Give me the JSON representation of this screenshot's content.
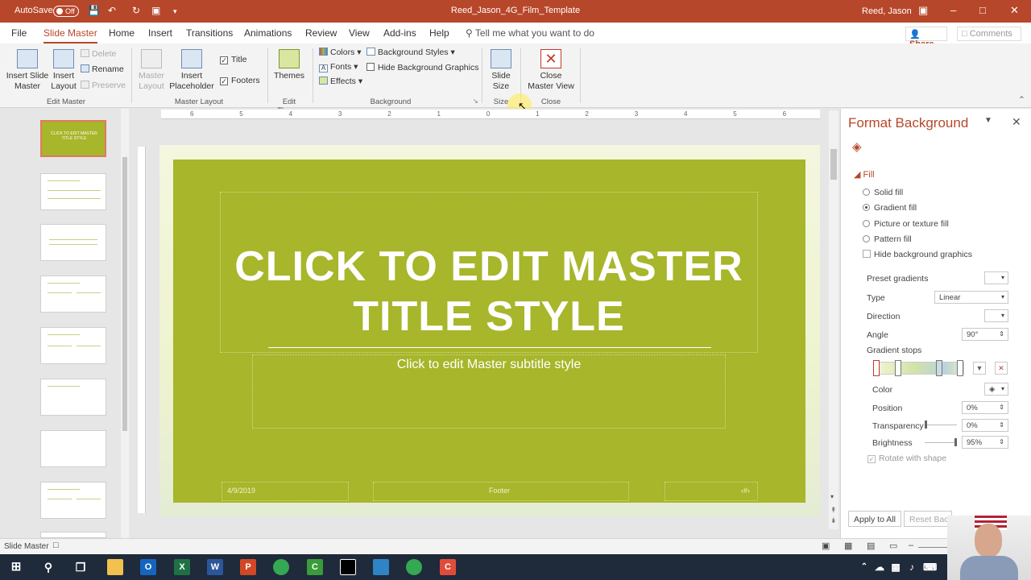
{
  "titlebar": {
    "autosave_label": "AutoSave",
    "autosave_state": "Off",
    "document_title": "Reed_Jason_4G_Film_Template",
    "user_name": "Reed, Jason"
  },
  "menu": {
    "tabs": [
      "File",
      "Slide Master",
      "Home",
      "Insert",
      "Transitions",
      "Animations",
      "Review",
      "View",
      "Add-ins",
      "Help"
    ],
    "active_tab": "Slide Master",
    "tell_me": "Tell me what you want to do",
    "share": "Share",
    "comments": "Comments"
  },
  "ribbon": {
    "insert_slide_master": "Insert Slide\nMaster",
    "insert_layout": "Insert\nLayout",
    "delete": "Delete",
    "rename": "Rename",
    "preserve": "Preserve",
    "master_layout": "Master\nLayout",
    "insert_placeholder": "Insert\nPlaceholder",
    "title_check": "Title",
    "footers_check": "Footers",
    "themes": "Themes",
    "colors": "Colors",
    "fonts": "Fonts",
    "effects": "Effects",
    "background_styles": "Background Styles",
    "hide_background_graphics": "Hide Background Graphics",
    "slide_size": "Slide\nSize",
    "close_master_view": "Close\nMaster View",
    "groups": {
      "edit_master": "Edit Master",
      "master_layout": "Master Layout",
      "edit_theme": "Edit Theme",
      "background": "Background",
      "size": "Size",
      "close": "Close"
    }
  },
  "slide": {
    "title": "CLICK TO EDIT MASTER TITLE STYLE",
    "subtitle": "Click to edit Master subtitle style",
    "date": "4/9/2019",
    "footer": "Footer",
    "number": "‹#›",
    "background_color": "#a7b62a"
  },
  "thumbnail": {
    "title": "CLICK TO EDIT MASTER TITLE STYLE"
  },
  "ruler": {
    "ticks": [
      "6",
      "5",
      "4",
      "3",
      "2",
      "1",
      "0",
      "1",
      "2",
      "3",
      "4",
      "5",
      "6"
    ]
  },
  "format_background": {
    "title": "Format Background",
    "section": "Fill",
    "options": [
      {
        "label": "Solid fill",
        "selected": false
      },
      {
        "label": "Gradient fill",
        "selected": true
      },
      {
        "label": "Picture or texture fill",
        "selected": false
      },
      {
        "label": "Pattern fill",
        "selected": false
      }
    ],
    "hide_graphics": "Hide background graphics",
    "preset_gradients": "Preset gradients",
    "type_label": "Type",
    "type_value": "Linear",
    "direction_label": "Direction",
    "angle_label": "Angle",
    "angle_value": "90°",
    "gradient_stops": "Gradient stops",
    "color_label": "Color",
    "position_label": "Position",
    "position_value": "0%",
    "transparency_label": "Transparency",
    "transparency_value": "0%",
    "brightness_label": "Brightness",
    "brightness_value": "95%",
    "rotate_with_shape": "Rotate with shape",
    "apply_to_all": "Apply to All",
    "reset_background": "Reset Bac"
  },
  "status": {
    "view": "Slide Master"
  },
  "colors": {
    "accent": "#b7472a",
    "slide_green": "#a7b62a"
  }
}
